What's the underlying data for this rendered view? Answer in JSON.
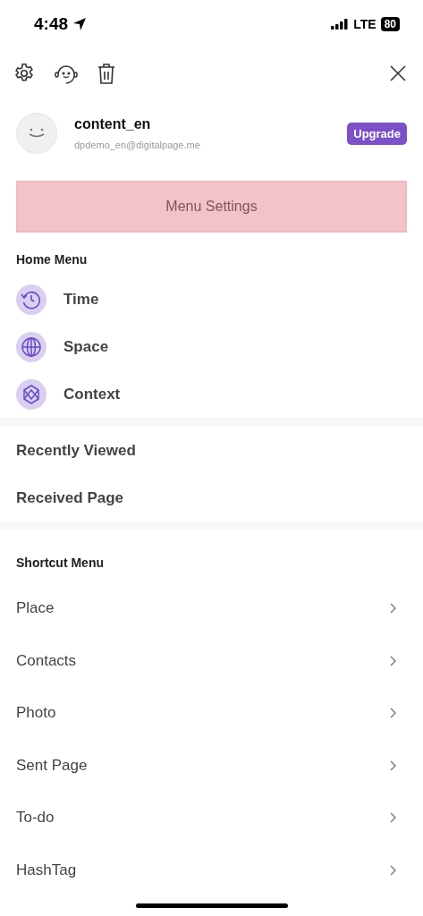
{
  "status_bar": {
    "time": "4:48",
    "network": "LTE",
    "battery": "80"
  },
  "profile": {
    "name": "content_en",
    "email": "dpdemo_en@digitalpage.me",
    "upgrade": "Upgrade"
  },
  "menu_settings": "Menu Settings",
  "home_menu": {
    "title": "Home Menu",
    "items": [
      {
        "label": "Time",
        "kind": "time"
      },
      {
        "label": "Space",
        "kind": "space"
      },
      {
        "label": "Context",
        "kind": "context"
      }
    ]
  },
  "pages": [
    "Recently Viewed",
    "Received Page"
  ],
  "shortcut_menu": {
    "title": "Shortcut Menu",
    "items": [
      "Place",
      "Contacts",
      "Photo",
      "Sent Page",
      "To-do",
      "HashTag"
    ]
  }
}
